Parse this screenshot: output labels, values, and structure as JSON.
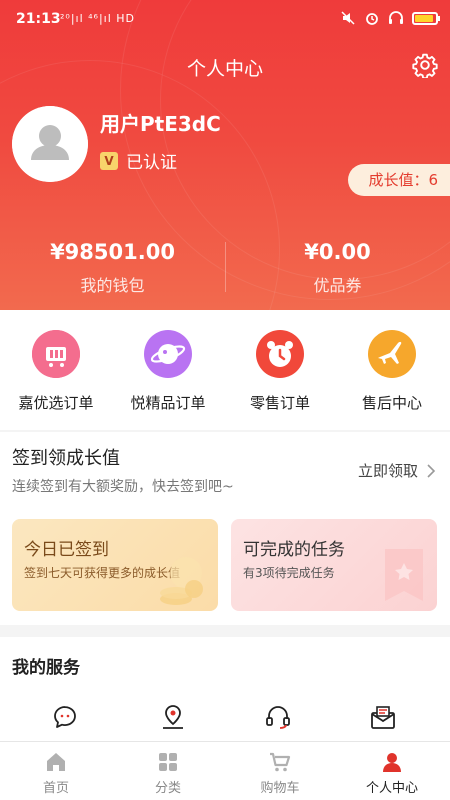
{
  "status_bar": {
    "time": "21:13",
    "network": "²⁰|ıl ⁴⁶|ıl HD",
    "battery_color": "#ffd42a"
  },
  "header": {
    "title": "个人中心",
    "settings_icon": "gear-icon"
  },
  "profile": {
    "username": "用户PtE3dC",
    "verified_badge": "V",
    "verified_label": "已认证",
    "growth_label": "成长值：6"
  },
  "wallet": {
    "balance": "¥98501.00",
    "balance_label": "我的钱包",
    "coupon": "¥0.00",
    "coupon_label": "优品券"
  },
  "orders": [
    {
      "label": "嘉优选订单",
      "icon": "cart-icon",
      "color": "#f0587a"
    },
    {
      "label": "悦精品订单",
      "icon": "planet-icon",
      "color": "#b86af0"
    },
    {
      "label": "零售订单",
      "icon": "alarm-clock-icon",
      "color": "#f04a3a"
    },
    {
      "label": "售后中心",
      "icon": "airplane-icon",
      "color": "#f5a623"
    }
  ],
  "signin": {
    "heading": "签到领成长值",
    "subtitle": "连续签到有大额奖励，快去签到吧~",
    "claim_label": "立即领取",
    "cards": [
      {
        "title": "今日已签到",
        "desc": "签到七天可获得更多的成长值"
      },
      {
        "title": "可完成的任务",
        "desc": "有3项待完成任务"
      }
    ]
  },
  "services": {
    "heading": "我的服务",
    "icons": [
      "chat-icon",
      "location-icon",
      "headset-icon",
      "mail-icon"
    ]
  },
  "tabbar": [
    {
      "label": "首页",
      "icon": "home-icon"
    },
    {
      "label": "分类",
      "icon": "grid-icon"
    },
    {
      "label": "购物车",
      "icon": "cart-icon"
    },
    {
      "label": "个人中心",
      "icon": "person-icon",
      "active": true
    }
  ],
  "colors": {
    "accent": "#ef3b3b",
    "active_tab": "#e0332b",
    "inactive_tab": "#b0b0b0"
  }
}
